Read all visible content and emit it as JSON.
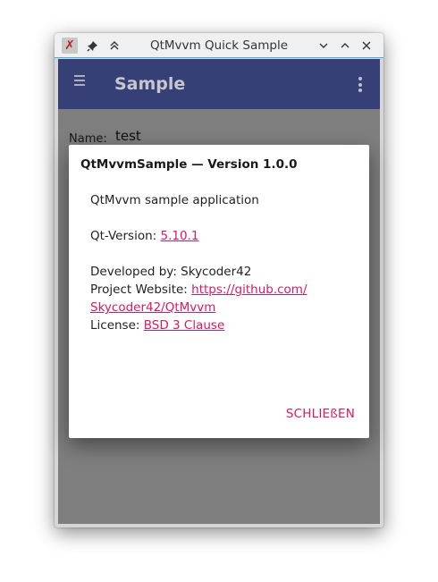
{
  "window": {
    "title": "QtMvvm Quick Sample",
    "icons": [
      "app-icon",
      "pin-icon",
      "keep-above-icon",
      "minimize-icon",
      "maximize-icon",
      "close-icon"
    ]
  },
  "appbar": {
    "title": "Sample",
    "color": "#3f4a8a",
    "icons": [
      "hamburger-menu-icon",
      "overflow-menu-icon"
    ]
  },
  "form": {
    "name_label": "Name:",
    "name_value": "test"
  },
  "dialog": {
    "title": "QtMvvmSample — Version 1.0.0",
    "description": "QtMvvm sample application",
    "qt_version_label": "Qt-Version: ",
    "qt_version_value": "5.10.1",
    "developed_by": "Developed by: Skycoder42",
    "website_label": "Project Website: ",
    "website_link_line1": "https://github.com/",
    "website_link_line2": "Skycoder42/QtMvvm",
    "license_label": "License: ",
    "license_value": "BSD 3 Clause",
    "close_button": "SCHLIEßEN",
    "accent_color": "#d81b60"
  }
}
